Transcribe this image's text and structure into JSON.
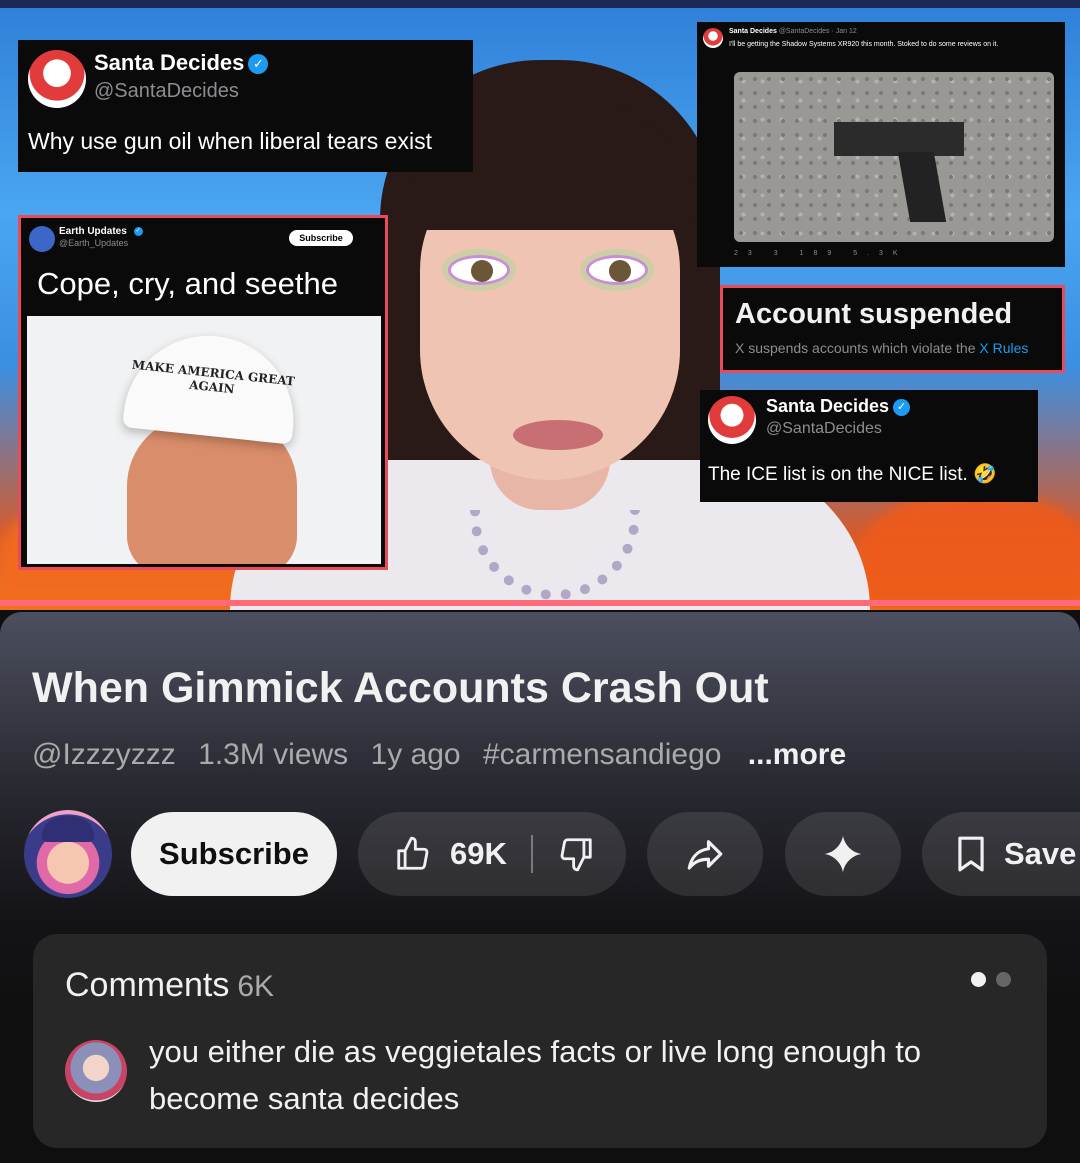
{
  "thumbnail": {
    "tweet1": {
      "name": "Santa Decides",
      "handle": "@SantaDecides",
      "text": "Why use gun oil when liberal tears exist"
    },
    "tweet2": {
      "name": "Earth Updates",
      "handle": "@Earth_Updates",
      "subscribe_label": "Subscribe",
      "text": "Cope, cry, and seethe",
      "hat_text": "MAKE AMERICA GREAT AGAIN"
    },
    "tweet3": {
      "name": "Santa Decides",
      "handle": "@SantaDecides · Jan 12",
      "text": "I'll be getting the Shadow Systems XR920 this month. Stoked to do some reviews on it.",
      "stats": "23 3 189 5.3K"
    },
    "suspended": {
      "title": "Account suspended",
      "subtitle_prefix": "X suspends accounts which violate the ",
      "subtitle_link": "X Rules"
    },
    "tweet4": {
      "name": "Santa Decides",
      "handle": "@SantaDecides",
      "text": "The ICE list is on the NICE list. 🤣"
    }
  },
  "video": {
    "title": "When Gimmick Accounts Crash Out",
    "channel_handle": "@Izzzyzzz",
    "views": "1.3M views",
    "age": "1y ago",
    "hashtag": "#carmensandiego",
    "more_label": "...more"
  },
  "actions": {
    "subscribe_label": "Subscribe",
    "like_count": "69K",
    "save_label": "Save",
    "icons": [
      "thumbs-up-icon",
      "thumbs-down-icon",
      "share-icon",
      "sparkle-icon",
      "bookmark-icon"
    ]
  },
  "comments": {
    "label": "Comments",
    "count": "6K",
    "top_comment": "you either die as veggietales facts or live long enough to become santa decides"
  },
  "colors": {
    "background": "#0f0f0f",
    "subscribe_bg": "#f1f1f1",
    "pill_bg": "#272727",
    "verified": "#1d9bf0"
  }
}
